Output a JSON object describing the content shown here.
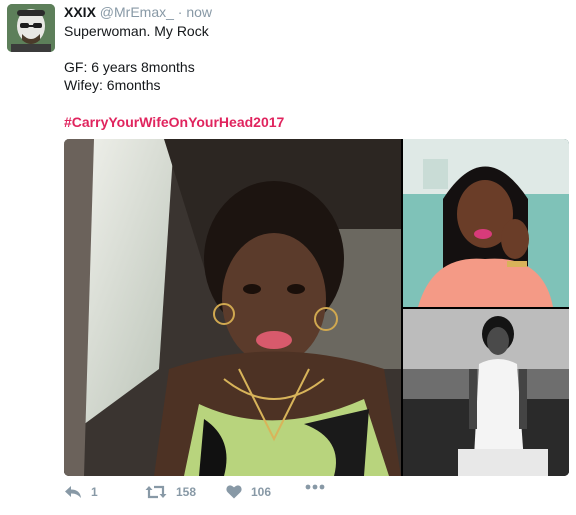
{
  "tweet": {
    "author_name": "XXIX",
    "author_handle": "@MrEmax_",
    "separator": "·",
    "timestamp": "now",
    "lines": [
      "Superwoman. My Rock",
      "",
      "GF: 6 years 8months",
      "Wifey: 6months",
      ""
    ],
    "hashtag": "#CarryYourWifeOnYourHead2017",
    "media_count": 3
  },
  "actions": {
    "reply_count": "1",
    "retweet_count": "158",
    "like_count": "106"
  },
  "icons": {
    "reply": "reply-icon",
    "retweet": "retweet-icon",
    "like": "heart-icon",
    "more": "more-dots-icon"
  },
  "colors": {
    "hashtag": "#e0245e",
    "muted": "#8899a6",
    "text": "#14171a"
  }
}
